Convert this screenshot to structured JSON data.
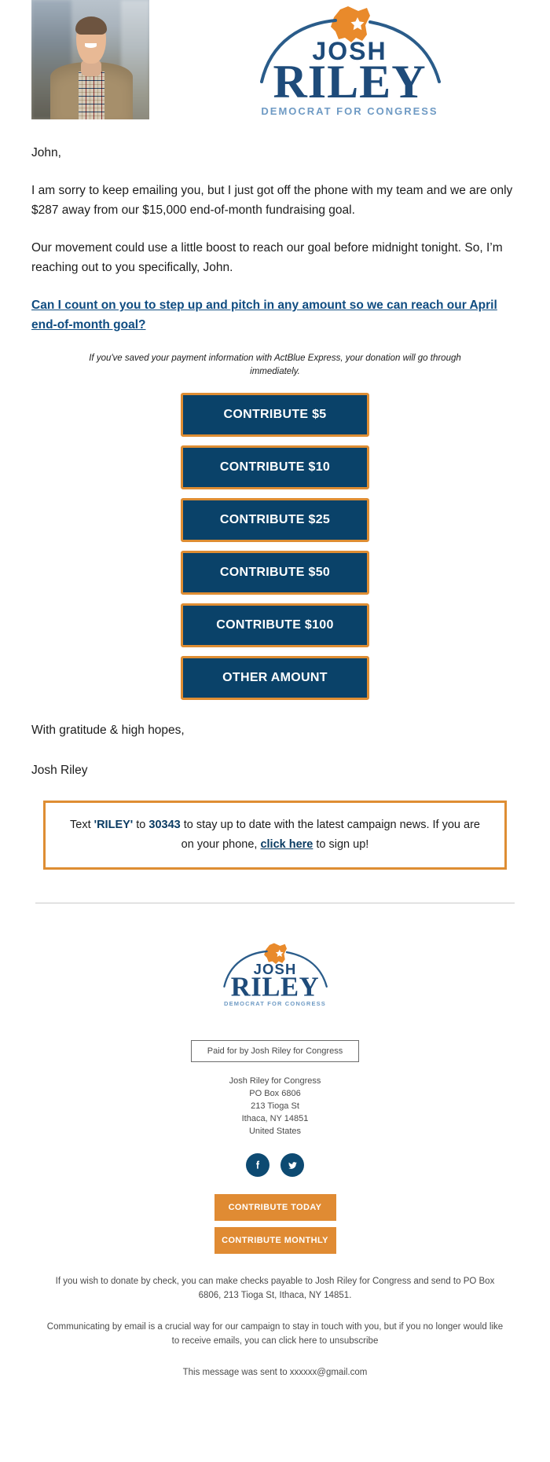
{
  "header": {
    "photo_alt": "Josh Riley portrait",
    "logo": {
      "name_top": "JOSH",
      "name_main": "RILEY",
      "tagline": "DEMOCRAT FOR CONGRESS"
    }
  },
  "colors": {
    "navy": "#0a4269",
    "logo_navy": "#1e4b7a",
    "orange": "#de8d33",
    "footer_orange": "#e08b33",
    "link_blue": "#0f4c81",
    "body_text": "#1c1c1c",
    "footer_text": "#4a4a4a"
  },
  "body": {
    "salutation": "John,",
    "paragraph_1": "I am sorry to keep emailing you, but I just got off the phone with my team and we are only $287 away from our $15,000 end-of-month fundraising goal.",
    "paragraph_2": "Our movement could use a little boost to reach our goal before midnight tonight. So, I’m reaching out to you specifically, John.",
    "cta_link": "Can I count on you to step up and pitch in any amount so we can reach our April end-of-month goal?",
    "actblue_note": "If you've saved your payment information with ActBlue Express, your donation will go through immediately.",
    "signoff_line_1": "With gratitude & high hopes,",
    "signoff_line_2": "Josh Riley"
  },
  "contribute_buttons": [
    {
      "label": "CONTRIBUTE $5",
      "amount": "5"
    },
    {
      "label": "CONTRIBUTE $10",
      "amount": "10"
    },
    {
      "label": "CONTRIBUTE $25",
      "amount": "25"
    },
    {
      "label": "CONTRIBUTE $50",
      "amount": "50"
    },
    {
      "label": "CONTRIBUTE $100",
      "amount": "100"
    },
    {
      "label": "OTHER AMOUNT",
      "amount": "other"
    }
  ],
  "sms_box": {
    "text_before_keyword": "Text ",
    "keyword": "'RILEY'",
    "text_between": " to ",
    "shortcode": "30343",
    "text_after_shortcode": " to stay up to date with the latest campaign news. If you are on your phone, ",
    "link_text": "click here",
    "text_end": " to sign up!"
  },
  "footer": {
    "logo": {
      "name_top": "JOSH",
      "name_main": "RILEY",
      "tagline": "DEMOCRAT FOR CONGRESS"
    },
    "paid_for": "Paid for by Josh Riley for Congress",
    "address_lines": [
      "Josh Riley for Congress",
      "PO Box 6806",
      "213 Tioga St",
      "Ithaca, NY 14851",
      "United States"
    ],
    "social": [
      {
        "name": "facebook",
        "glyph": "f"
      },
      {
        "name": "twitter",
        "glyph": "t"
      }
    ],
    "buttons": [
      {
        "label": "CONTRIBUTE TODAY"
      },
      {
        "label": "CONTRIBUTE MONTHLY"
      }
    ],
    "check_notice": "If you wish to donate by check, you can make checks payable to Josh Riley for Congress and send to PO Box 6806, 213 Tioga St, Ithaca, NY 14851.",
    "unsubscribe_notice": "Communicating by email is a crucial way for our campaign to stay in touch with you, but if you no longer would like to receive emails, you can click here to unsubscribe",
    "sent_to": "This message was sent to xxxxxx@gmail.com"
  }
}
